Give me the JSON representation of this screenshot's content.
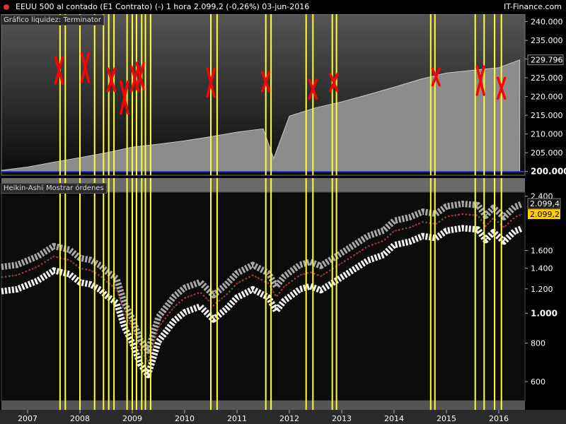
{
  "header": {
    "title": "EEUU 500 al contado (E1 Contrato) (-)   1 hora   2.099,2 (-0,26%)   03-jun-2016",
    "brand": "IT-Finance.com"
  },
  "top_panel": {
    "label": "Gráfico liquidez: Terminator"
  },
  "bottom_panel": {
    "label": "Heikin-Ashi",
    "orders_button": "Mostrar órdenes"
  },
  "colors": {
    "background": "#000000",
    "area_fill": "#8c8c8c",
    "signal_line": "#ffff33",
    "cross_marker": "#ff0000",
    "baseline": "#3344cc",
    "last_price_badge": "#ffcc00"
  },
  "chart_data": [
    {
      "type": "area",
      "title": "Gráfico liquidez: Terminator",
      "x_range": [
        2006.5,
        2016.5
      ],
      "ylim": [
        199.0,
        242.0
      ],
      "y_ticks": [
        "240.000",
        "235.000",
        "230.000",
        "225.000",
        "220.000",
        "215.000",
        "210.000",
        "205.000",
        "200.000"
      ],
      "y_tick_values": [
        240,
        235,
        230,
        225,
        220,
        215,
        210,
        205,
        200
      ],
      "last_value_label": "229.796",
      "baseline_value": 200.0,
      "series": [
        {
          "x": [
            2006.5,
            2007.0,
            2007.5,
            2008.0,
            2008.5,
            2009.0,
            2009.5,
            2010.0,
            2010.5,
            2011.0,
            2011.5,
            2011.7,
            2012.0,
            2012.5,
            2013.0,
            2013.5,
            2014.0,
            2014.5,
            2015.0,
            2015.5,
            2016.0,
            2016.4
          ],
          "values": [
            200.3,
            201.2,
            202.5,
            203.7,
            205.0,
            206.5,
            207.3,
            208.2,
            209.3,
            210.5,
            211.4,
            203.5,
            214.8,
            217.0,
            218.6,
            220.5,
            222.5,
            224.6,
            226.3,
            227.0,
            227.7,
            229.8
          ]
        }
      ],
      "cross_markers": [
        {
          "x": 2007.6,
          "y_range": [
            223.5,
            230.5
          ]
        },
        {
          "x": 2008.1,
          "y_range": [
            224.0,
            231.5
          ]
        },
        {
          "x": 2008.6,
          "y_range": [
            221.5,
            227.5
          ]
        },
        {
          "x": 2008.85,
          "y_range": [
            215.5,
            224.0
          ]
        },
        {
          "x": 2009.05,
          "y_range": [
            221.5,
            228.0
          ]
        },
        {
          "x": 2009.15,
          "y_range": [
            222.0,
            229.0
          ]
        },
        {
          "x": 2010.5,
          "y_range": [
            220.0,
            227.5
          ]
        },
        {
          "x": 2011.55,
          "y_range": [
            221.5,
            226.5
          ]
        },
        {
          "x": 2012.45,
          "y_range": [
            219.5,
            224.5
          ]
        },
        {
          "x": 2012.85,
          "y_range": [
            221.5,
            226.0
          ]
        },
        {
          "x": 2014.8,
          "y_range": [
            223.0,
            227.5
          ]
        },
        {
          "x": 2015.65,
          "y_range": [
            220.5,
            228.0
          ]
        },
        {
          "x": 2016.05,
          "y_range": [
            219.5,
            225.0
          ]
        }
      ]
    },
    {
      "type": "line",
      "title": "Heikin-Ashi",
      "x_range": [
        2006.5,
        2016.5
      ],
      "y_scale": "log",
      "ylim": [
        520,
        2500
      ],
      "y_ticks": [
        "2.400",
        "1.600",
        "1.400",
        "1.200",
        "1.000",
        "800",
        "600"
      ],
      "y_tick_values": [
        2400,
        1600,
        1400,
        1200,
        1000,
        800,
        600
      ],
      "bold_tick": "1.000",
      "value_badges": [
        "2.099,4",
        "2.099,2"
      ],
      "series": [
        {
          "x": [
            2006.5,
            2006.8,
            2007.2,
            2007.5,
            2007.8,
            2008.0,
            2008.2,
            2008.4,
            2008.5,
            2008.7,
            2008.85,
            2009.0,
            2009.15,
            2009.3,
            2009.5,
            2009.8,
            2010.0,
            2010.3,
            2010.55,
            2010.8,
            2011.0,
            2011.3,
            2011.6,
            2011.75,
            2011.9,
            2012.2,
            2012.4,
            2012.6,
            2012.9,
            2013.2,
            2013.5,
            2013.8,
            2014.0,
            2014.3,
            2014.55,
            2014.8,
            2015.0,
            2015.3,
            2015.6,
            2015.75,
            2015.9,
            2016.1,
            2016.3,
            2016.45
          ],
          "values": [
            1310,
            1330,
            1420,
            1530,
            1490,
            1400,
            1380,
            1320,
            1270,
            1200,
            1000,
            890,
            760,
            700,
            900,
            1050,
            1120,
            1170,
            1060,
            1150,
            1250,
            1330,
            1250,
            1130,
            1220,
            1330,
            1360,
            1320,
            1420,
            1530,
            1650,
            1720,
            1850,
            1900,
            1980,
            1950,
            2060,
            2100,
            2080,
            1920,
            2040,
            1900,
            2050,
            2099.2
          ]
        }
      ]
    }
  ],
  "signal_lines_x": [
    2007.62,
    2007.72,
    2008.0,
    2008.28,
    2008.45,
    2008.55,
    2008.65,
    2008.9,
    2009.0,
    2009.08,
    2009.18,
    2009.25,
    2009.35,
    2010.5,
    2010.62,
    2011.55,
    2011.65,
    2012.32,
    2012.45,
    2012.82,
    2012.9,
    2014.7,
    2014.78,
    2015.55,
    2015.72,
    2015.92,
    2016.05
  ],
  "x_axis": {
    "labels": [
      "2007",
      "2008",
      "2009",
      "2010",
      "2011",
      "2012",
      "2013",
      "2014",
      "2015",
      "2016"
    ],
    "values": [
      2007,
      2008,
      2009,
      2010,
      2011,
      2012,
      2013,
      2014,
      2015,
      2016
    ]
  }
}
